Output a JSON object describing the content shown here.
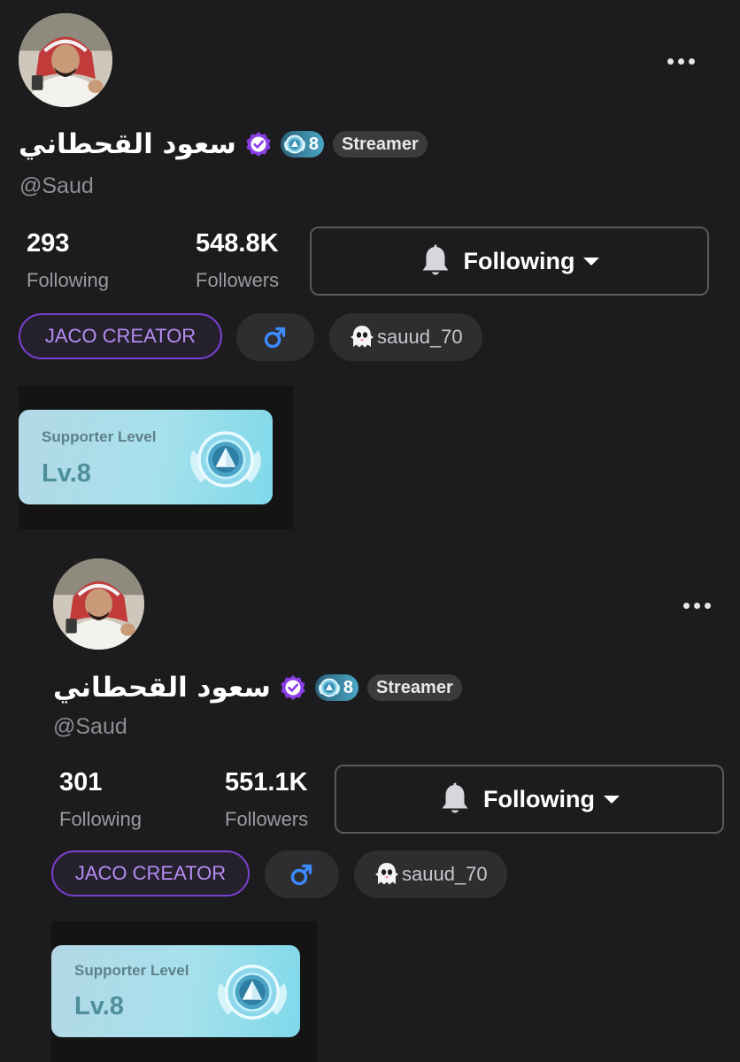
{
  "icons": {
    "more": "more-horizontal-icon",
    "verified": "verified-check-icon",
    "level": "level-emblem-icon",
    "bell": "bell-icon",
    "caret": "caret-down-icon",
    "gender": "male-icon",
    "ghost": "ghost-icon"
  },
  "colors": {
    "background": "#1c1c1e",
    "verified": "#8a3ee6",
    "creator_border": "#7b3fd1",
    "creator_text": "#b58cf2",
    "gender_icon": "#3d8bff",
    "supporter_card": "#a6e1ec"
  },
  "profiles": [
    {
      "display_name": "سعود القحطاني",
      "level_badge": "8",
      "role_badge": "Streamer",
      "handle": "@Saud",
      "following_count": "293",
      "following_label": "Following",
      "followers_count": "548.8K",
      "followers_label": "Followers",
      "follow_button_label": "Following",
      "creator_tag": "JACO CREATOR",
      "social_handle": "sauud_70",
      "supporter_title": "Supporter Level",
      "supporter_level": "Lv.8"
    },
    {
      "display_name": "سعود القحطاني",
      "level_badge": "8",
      "role_badge": "Streamer",
      "handle": "@Saud",
      "following_count": "301",
      "following_label": "Following",
      "followers_count": "551.1K",
      "followers_label": "Followers",
      "follow_button_label": "Following",
      "creator_tag": "JACO CREATOR",
      "social_handle": "sauud_70",
      "supporter_title": "Supporter Level",
      "supporter_level": "Lv.8"
    }
  ]
}
